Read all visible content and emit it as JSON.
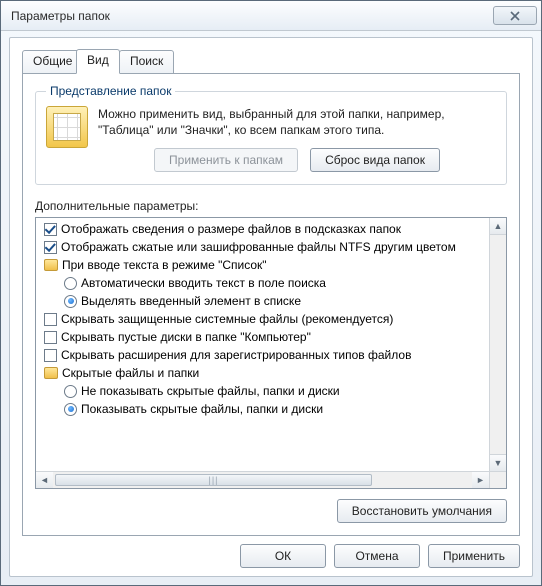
{
  "window": {
    "title": "Параметры папок"
  },
  "tabs": {
    "general": "Общие",
    "view": "Вид",
    "search": "Поиск"
  },
  "folderview": {
    "legend": "Представление папок",
    "text": "Можно применить вид, выбранный для этой папки, например, \"Таблица\" или \"Значки\", ко всем папкам этого типа.",
    "apply_btn": "Применить к папкам",
    "reset_btn": "Сброс вида папок"
  },
  "advanced": {
    "label": "Дополнительные параметры:",
    "items": [
      {
        "type": "check",
        "checked": true,
        "text": "Отображать сведения о размере файлов в подсказках папок"
      },
      {
        "type": "check",
        "checked": true,
        "text": "Отображать сжатые или зашифрованные файлы NTFS другим цветом"
      },
      {
        "type": "group",
        "text": "При вводе текста в режиме \"Список\""
      },
      {
        "type": "radio",
        "checked": false,
        "text": "Автоматически вводить текст в поле поиска"
      },
      {
        "type": "radio",
        "checked": true,
        "text": "Выделять введенный элемент в списке"
      },
      {
        "type": "check",
        "checked": false,
        "text": "Скрывать защищенные системные файлы (рекомендуется)"
      },
      {
        "type": "check",
        "checked": false,
        "text": "Скрывать пустые диски в папке \"Компьютер\""
      },
      {
        "type": "check",
        "checked": false,
        "text": "Скрывать расширения для зарегистрированных типов файлов"
      },
      {
        "type": "group",
        "text": "Скрытые файлы и папки"
      },
      {
        "type": "radio",
        "checked": false,
        "text": "Не показывать скрытые файлы, папки и диски"
      },
      {
        "type": "radio",
        "checked": true,
        "text": "Показывать скрытые файлы, папки и диски"
      }
    ]
  },
  "restore_defaults": "Восстановить умолчания",
  "buttons": {
    "ok": "ОК",
    "cancel": "Отмена",
    "apply": "Применить"
  }
}
